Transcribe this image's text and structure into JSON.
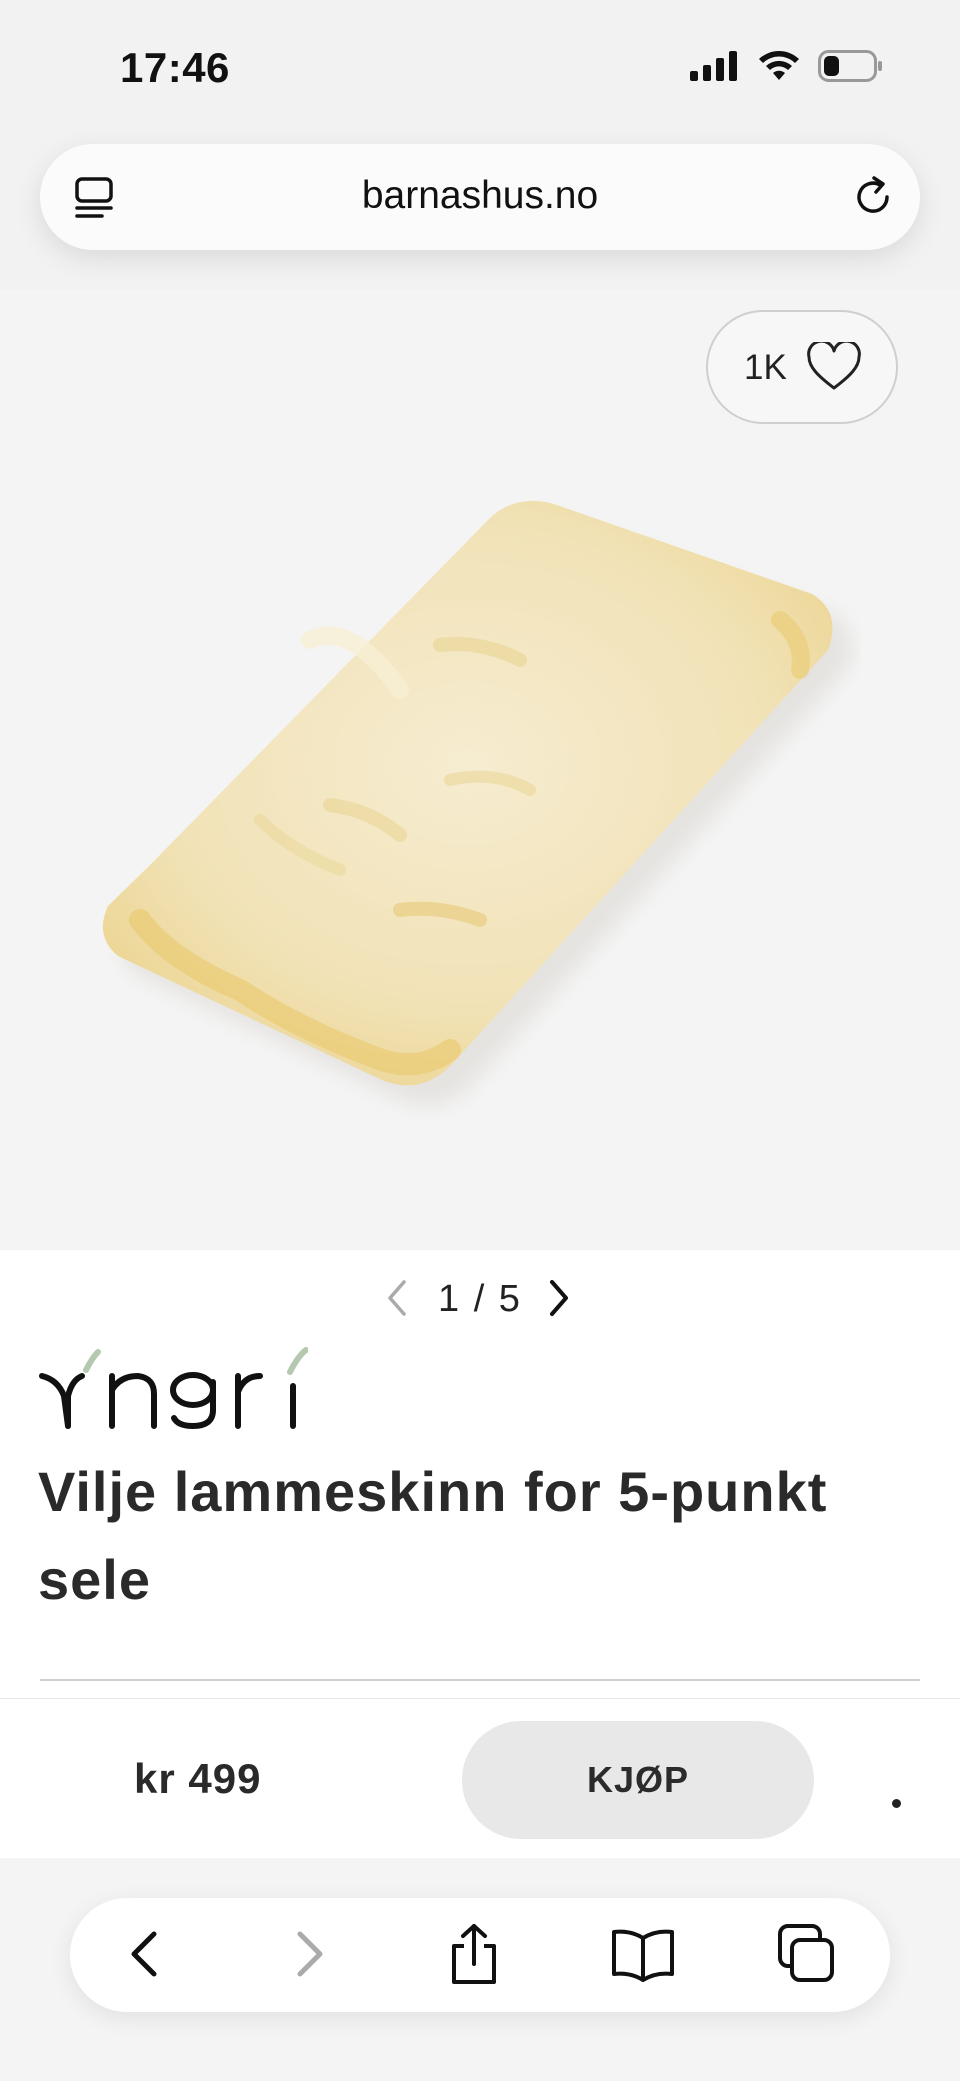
{
  "status_bar": {
    "time": "17:46",
    "icons": [
      "signal-icon",
      "wifi-icon",
      "battery-icon"
    ]
  },
  "browser": {
    "url": "barnashus.no",
    "icons": [
      "tabs-list-icon",
      "reload-icon"
    ]
  },
  "product_gallery": {
    "like_count": "1K",
    "pager_text": "1 / 5",
    "current_image": 1,
    "total_images": 5
  },
  "product": {
    "brand": "Yngri",
    "title": "Vilje lammeskinn for 5-punkt sele"
  },
  "purchase": {
    "price": "kr 499",
    "buy_label": "KJØP"
  },
  "toolbar": {
    "items": [
      "back-icon",
      "forward-icon",
      "share-icon",
      "bookmarks-icon",
      "tabs-icon"
    ]
  },
  "colors": {
    "accent_leaf": "#b5c9b0",
    "buy_button_bg": "#e8e8e8",
    "fleece": "#f1e3b8"
  }
}
